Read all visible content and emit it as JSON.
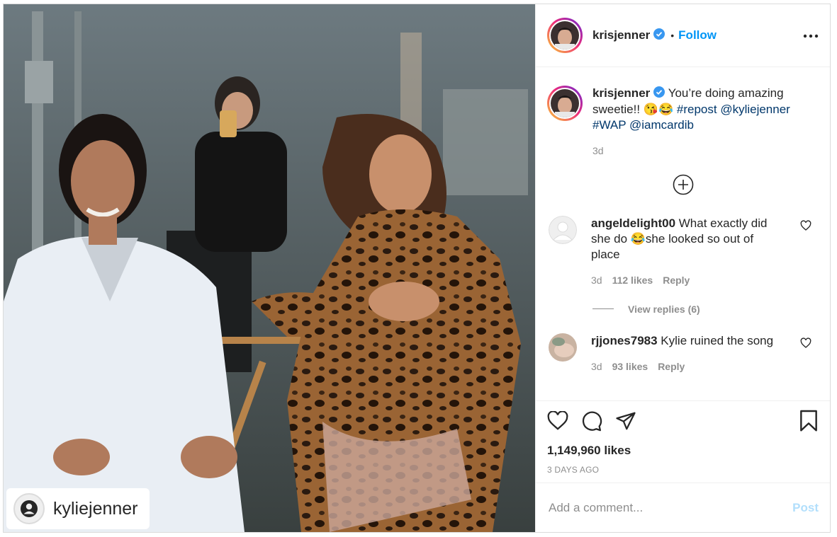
{
  "post": {
    "author": "krisjenner",
    "follow_label": "Follow",
    "dot": "•",
    "photo_tag": "kyliejenner"
  },
  "caption": {
    "username": "krisjenner",
    "text_plain": "You’re doing amazing sweetie!! 😘😂 ",
    "hashtag1": "#repost",
    "mention1": "@kyliejenner",
    "hashtag2": "#WAP",
    "mention2": "@iamcardib",
    "age": "3d"
  },
  "comments": [
    {
      "username": "angeldelight00",
      "text": "What exactly did she do 😂she looked so out of place",
      "age": "3d",
      "likes": "112 likes",
      "reply_label": "Reply",
      "view_replies": "View replies (6)"
    },
    {
      "username": "rjjones7983",
      "text": "Kylie ruined the song",
      "age": "3d",
      "likes": "93 likes",
      "reply_label": "Reply"
    }
  ],
  "engagement": {
    "likes": "1,149,960 likes",
    "date": "3 DAYS AGO"
  },
  "composer": {
    "placeholder": "Add a comment...",
    "post_label": "Post"
  },
  "icons": {
    "verified": "verified-badge-icon",
    "more": "more-options-icon",
    "load_more": "plus-circle-icon",
    "like": "heart-icon",
    "comment": "comment-bubble-icon",
    "share": "paper-plane-icon",
    "save": "bookmark-icon",
    "accent": "#0095f6"
  }
}
